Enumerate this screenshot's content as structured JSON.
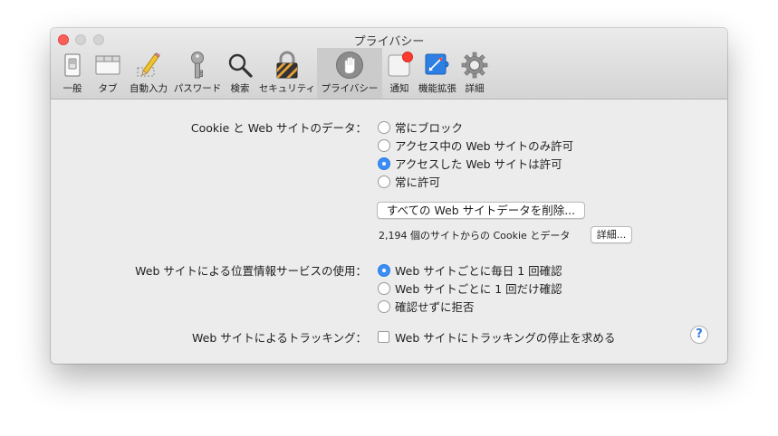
{
  "window": {
    "title": "プライバシー"
  },
  "toolbar": {
    "items": [
      {
        "label": "一般",
        "icon": "general-switch-icon"
      },
      {
        "label": "タブ",
        "icon": "tabs-icon"
      },
      {
        "label": "自動入力",
        "icon": "autofill-pencil-icon"
      },
      {
        "label": "パスワード",
        "icon": "key-icon"
      },
      {
        "label": "検索",
        "icon": "search-icon"
      },
      {
        "label": "セキュリティ",
        "icon": "padlock-icon"
      },
      {
        "label": "プライバシー",
        "icon": "hand-icon",
        "selected": true
      },
      {
        "label": "通知",
        "icon": "notification-badge-icon"
      },
      {
        "label": "機能拡張",
        "icon": "extensions-puzzle-icon"
      },
      {
        "label": "詳細",
        "icon": "gear-icon"
      }
    ]
  },
  "cookies": {
    "label": "Cookie と Web サイトのデータ：",
    "options": [
      {
        "label": "常にブロック",
        "checked": false
      },
      {
        "label": "アクセス中の Web サイトのみ許可",
        "checked": false
      },
      {
        "label": "アクセスした Web サイトは許可",
        "checked": true
      },
      {
        "label": "常に許可",
        "checked": false
      }
    ],
    "remove_all_button": "すべての Web サイトデータを削除...",
    "count_text": "2,194 個のサイトからの Cookie とデータ",
    "details_button": "詳細..."
  },
  "location": {
    "label": "Web サイトによる位置情報サービスの使用：",
    "options": [
      {
        "label": "Web サイトごとに毎日 1 回確認",
        "checked": true
      },
      {
        "label": "Web サイトごとに 1 回だけ確認",
        "checked": false
      },
      {
        "label": "確認せずに拒否",
        "checked": false
      }
    ]
  },
  "tracking": {
    "label": "Web サイトによるトラッキング：",
    "checkbox_label": "Web サイトにトラッキングの停止を求める",
    "checked": false
  },
  "help": {
    "symbol": "?"
  },
  "colors": {
    "accent": "#3a8ef6",
    "close": "#fc5f57",
    "badge": "#ff3b30"
  }
}
